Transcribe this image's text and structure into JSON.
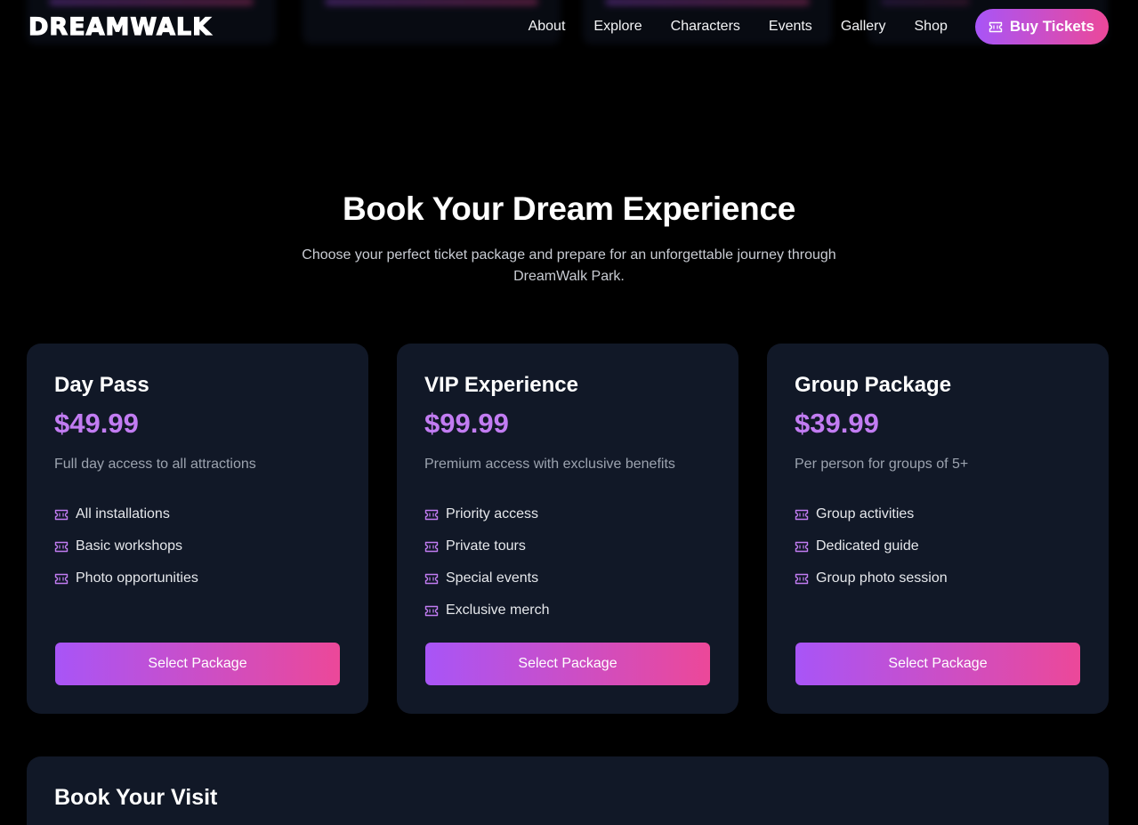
{
  "header": {
    "logo_text": "DREAMWALK",
    "nav": [
      "About",
      "Explore",
      "Characters",
      "Events",
      "Gallery",
      "Shop"
    ],
    "cta_label": "Buy Tickets",
    "cta_icon": "ticket-icon"
  },
  "hero": {
    "title": "Book Your Dream Experience",
    "subtitle": "Choose your perfect ticket package and prepare for an unforgettable journey through DreamWalk Park."
  },
  "packages": [
    {
      "name": "Day Pass",
      "price": "$49.99",
      "description": "Full day access to all attractions",
      "features": [
        "All installations",
        "Basic workshops",
        "Photo opportunities"
      ],
      "button_label": "Select Package"
    },
    {
      "name": "VIP Experience",
      "price": "$99.99",
      "description": "Premium access with exclusive benefits",
      "features": [
        "Priority access",
        "Private tours",
        "Special events",
        "Exclusive merch"
      ],
      "button_label": "Select Package"
    },
    {
      "name": "Group Package",
      "price": "$39.99",
      "description": "Per person for groups of 5+",
      "features": [
        "Group activities",
        "Dedicated guide",
        "Group photo session"
      ],
      "button_label": "Select Package"
    }
  ],
  "booking": {
    "title": "Book Your Visit"
  },
  "colors": {
    "background": "#000000",
    "card": "#111827",
    "accent_start": "#a855f7",
    "accent_end": "#ec4899",
    "price": "#c27cf2"
  }
}
